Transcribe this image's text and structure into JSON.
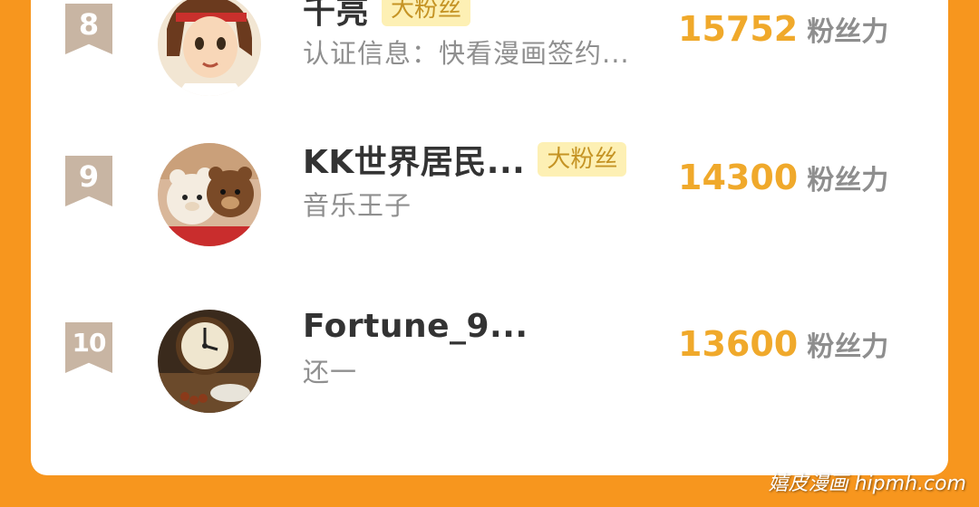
{
  "score_unit": "粉丝力",
  "rows": [
    {
      "rank": "8",
      "name": "千亮",
      "badge": "大粉丝",
      "description": "认证信息：快看漫画签约...",
      "score": "15752",
      "avatar_icon": "anime-girl-avatar"
    },
    {
      "rank": "9",
      "name": "KK世界居民...",
      "badge": "大粉丝",
      "description": "音乐王子",
      "score": "14300",
      "avatar_icon": "plush-bear-avatar"
    },
    {
      "rank": "10",
      "name": "Fortune_9...",
      "badge": "",
      "description": "还一",
      "score": "13600",
      "avatar_icon": "clock-avatar"
    }
  ],
  "watermark": "嬉皮漫画 hipmh.com",
  "colors": {
    "background": "#f7961e",
    "card": "#ffffff",
    "score": "#f0a92b",
    "badge_bg": "#fdf0b4",
    "badge_text": "#c59425",
    "rank_bg": "#c8b5a3"
  }
}
